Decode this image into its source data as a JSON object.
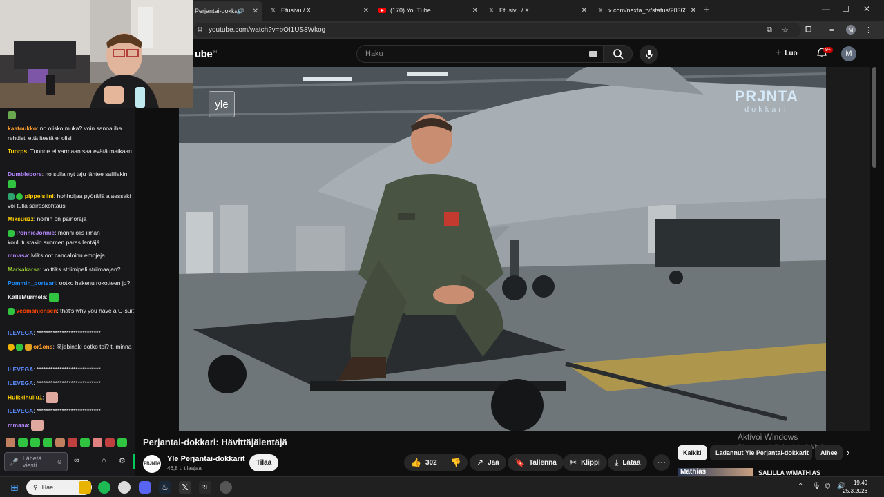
{
  "browser": {
    "tabs": [
      {
        "title": "Perjantai-dokkari: Hävittäjälentäjä",
        "active": true,
        "icon": "speaker-icon"
      },
      {
        "title": "Etusivu / X",
        "active": false,
        "icon": "x-icon"
      },
      {
        "title": "(170) YouTube",
        "active": false,
        "icon": "youtube-icon"
      },
      {
        "title": "Etusivu / X",
        "active": false,
        "icon": "x-icon"
      },
      {
        "title": "x.com/nexta_tv/status/2036578...",
        "active": false,
        "icon": "x-icon"
      }
    ],
    "url": "youtube.com/watch?v=bOI1US8Wkog",
    "profile_initial": "M"
  },
  "youtube": {
    "logo": "ube",
    "region": "FI",
    "search_placeholder": "Haku",
    "create_label": "Luo",
    "notif_count": "9+",
    "avatar_initial": "M",
    "video": {
      "bug_left": "yle",
      "bug_right_top": "PRJNTA",
      "bug_right_bottom": "dokkari"
    },
    "title": "Perjantai-dokkari: Hävittäjälentäjä",
    "channel": {
      "name": "Yle Perjantai-dokkarit",
      "subscribers": "46,8 t. tilaajaa",
      "logo_text": "PRJNTA"
    },
    "subscribe_label": "Tilaa",
    "likes": "302",
    "actions": {
      "share": "Jaa",
      "save": "Tallenna",
      "clip": "Klippi",
      "download": "Lataa"
    },
    "chips": [
      {
        "label": "Kaikki",
        "selected": true
      },
      {
        "label": "Ladannut Yle Perjantai-dokkarit",
        "selected": false
      },
      {
        "label": "Aihee",
        "selected": false
      }
    ],
    "watermark_line1": "Aktivoi Windows",
    "watermark_line2": "Siirry asetuksiin ja aktivoi Windows.",
    "related": {
      "thumb_text": "Mathias",
      "title": "SALILLA w/MATHIAS"
    }
  },
  "chat": {
    "messages": [
      {
        "user": "kaatoukko",
        "color": "#ff9f2e",
        "text": "no olisko muka? voin sanoa iha rehdisti että itestä ei olisi"
      },
      {
        "user": "Tuorps",
        "color": "#ffd000",
        "text": "Tuonne ei varmaan saa evätä matkaan"
      },
      {
        "user": "Dumblebore",
        "color": "#b689ff",
        "text": "no sulla nyt taju lähtee salillakin"
      },
      {
        "user": "pippelsiini",
        "color": "#ffd000",
        "text": "hohhoijaa pyörällä ajaessaki voi tulla sairaskohtaus"
      },
      {
        "user": "Miksuuzz",
        "color": "#ffd000",
        "text": "noihin on painoraja"
      },
      {
        "user": "PonnieJonnie",
        "color": "#b689ff",
        "text": "monni olis ilman koulutustakin suomen paras lentäjä"
      },
      {
        "user": "mmasa",
        "color": "#b689ff",
        "text": "Miks oot cancaloinu emojeja"
      },
      {
        "user": "Markakarsa",
        "color": "#9acd32",
        "text": "voittiks striimipeli striimaajan?"
      },
      {
        "user": "Pommin_portsari",
        "color": "#1e90ff",
        "text": "ootko hakenu rokotteen jo?"
      },
      {
        "user": "KalleMurmela",
        "color": "#efeff1",
        "text": ""
      },
      {
        "user": "yeomanjensen",
        "color": "#ff4500",
        "text": "that's why you have a G-suit"
      },
      {
        "user": "ILEVEGA",
        "color": "#5b8bff",
        "text": "****************************"
      },
      {
        "user": "or1ons",
        "color": "#ff9f2e",
        "text": "@jebinaki ootko toi? t, minna"
      },
      {
        "user": "ILEVEGA",
        "color": "#5b8bff",
        "text": "****************************"
      },
      {
        "user": "ILEVEGA",
        "color": "#5b8bff",
        "text": "****************************"
      },
      {
        "user": "Hulkkihullu1",
        "color": "#ffd000",
        "text": ""
      },
      {
        "user": "ILEVEGA",
        "color": "#5b8bff",
        "text": "****************************"
      },
      {
        "user": "mmasa",
        "color": "#b689ff",
        "text": ""
      }
    ],
    "input_placeholder": "Lähetä viesti"
  },
  "taskbar": {
    "search_label": "Hae",
    "time": "19.40",
    "date": "25.3.2026"
  },
  "colors": {
    "youtube_red": "#cc0000",
    "twitch_purple": "#a970ff",
    "twitch_green": "#00c85a"
  }
}
